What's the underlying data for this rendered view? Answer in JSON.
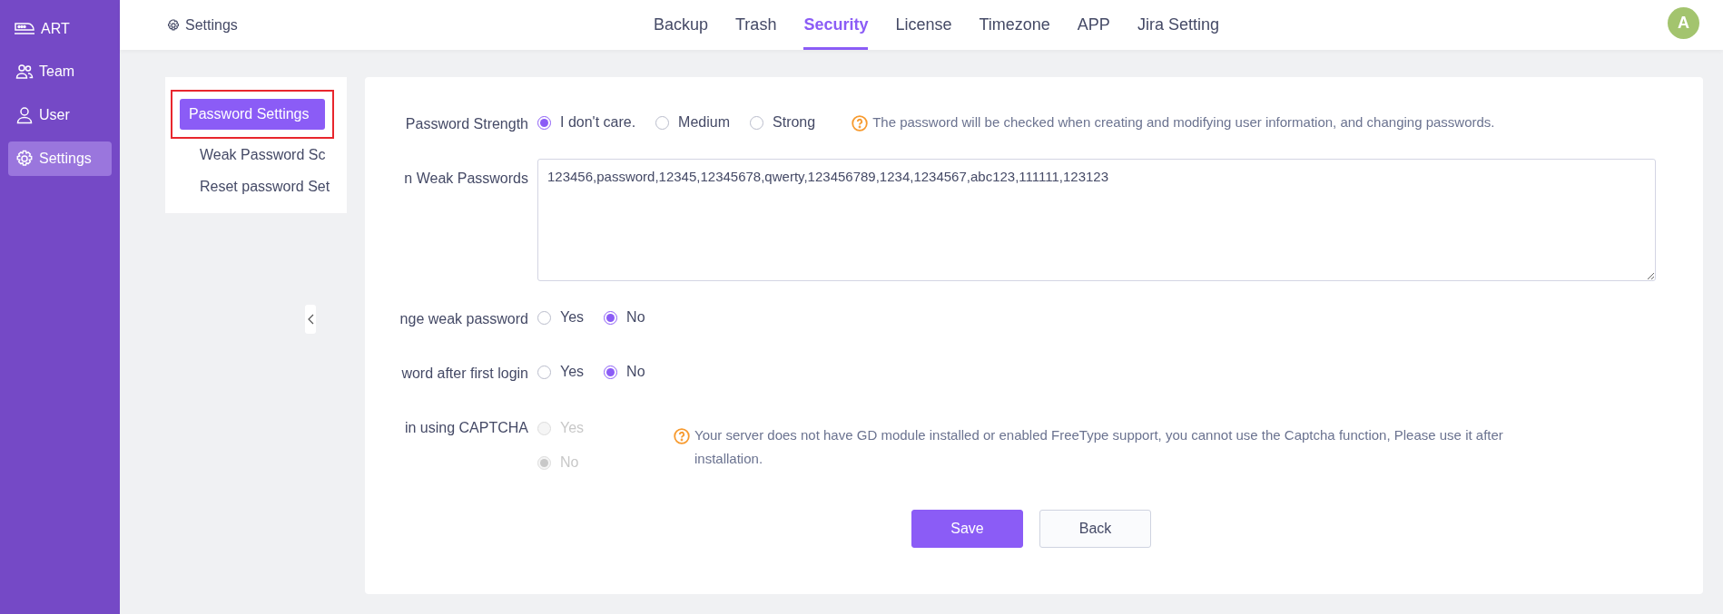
{
  "sidebar": {
    "brand": "ART",
    "items": [
      {
        "label": "Team",
        "kind": "team",
        "selected": false
      },
      {
        "label": "User",
        "kind": "user",
        "selected": false
      },
      {
        "label": "Settings",
        "kind": "settings",
        "selected": true
      }
    ]
  },
  "header": {
    "breadcrumb": "Settings",
    "tabs": [
      {
        "label": "Backup",
        "selected": false
      },
      {
        "label": "Trash",
        "selected": false
      },
      {
        "label": "Security",
        "selected": true
      },
      {
        "label": "License",
        "selected": false
      },
      {
        "label": "Timezone",
        "selected": false
      },
      {
        "label": "APP",
        "selected": false
      },
      {
        "label": "Jira Setting",
        "selected": false
      }
    ],
    "avatar": "A"
  },
  "subnav": {
    "items": [
      {
        "label": "Password Settings",
        "selected": true
      },
      {
        "label": "Weak Password Sc",
        "selected": false
      },
      {
        "label": "Reset password Set",
        "selected": false
      }
    ]
  },
  "form": {
    "fields": [
      {
        "kind": "radio",
        "label": "Password Strength",
        "disabled": false,
        "options": [
          {
            "label": "I don't care.",
            "selected": true
          },
          {
            "label": "Medium",
            "selected": false
          },
          {
            "label": "Strong",
            "selected": false
          }
        ],
        "hint": "The password will be checked when creating and modifying user information, and changing passwords."
      },
      {
        "kind": "textarea",
        "label": "n Weak Passwords",
        "value": "123456,password,12345,12345678,qwerty,123456789,1234,1234567,abc123,111111,123123"
      },
      {
        "kind": "radio",
        "label": "nge weak password",
        "disabled": false,
        "options": [
          {
            "label": "Yes",
            "selected": false
          },
          {
            "label": "No",
            "selected": true
          }
        ]
      },
      {
        "kind": "radio",
        "label": "word after first login",
        "disabled": false,
        "options": [
          {
            "label": "Yes",
            "selected": false
          },
          {
            "label": "No",
            "selected": true
          }
        ]
      },
      {
        "kind": "radio-stacked",
        "label": "in using CAPTCHA",
        "disabled": true,
        "options": [
          {
            "label": "Yes",
            "selected": false
          },
          {
            "label": "No",
            "selected": true
          }
        ],
        "hint": "Your server does not have GD module installed or enabled FreeType support, you cannot use the Captcha function, Please use it after installation."
      }
    ],
    "buttons": [
      {
        "label": "Save",
        "kind": "primary"
      },
      {
        "label": "Back",
        "kind": "default"
      }
    ]
  }
}
